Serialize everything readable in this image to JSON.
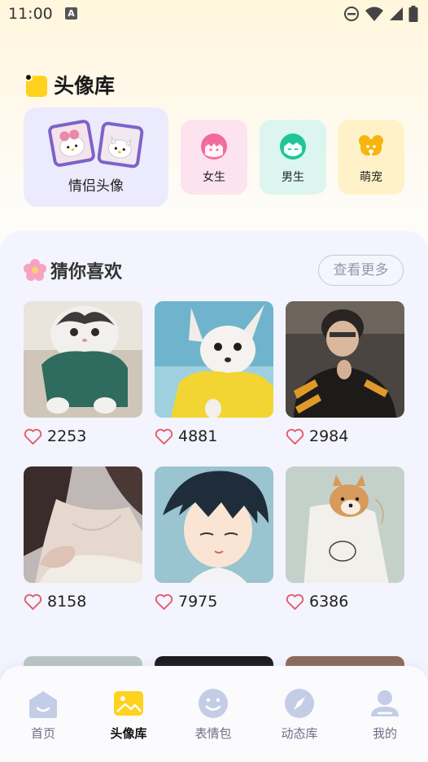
{
  "status": {
    "time": "11:00",
    "a_badge": "A"
  },
  "library": {
    "title": "头像库"
  },
  "categories": {
    "couple": "情侣头像",
    "girl": "女生",
    "boy": "男生",
    "pet": "萌宠"
  },
  "recommend": {
    "title": "猜你喜欢",
    "more": "查看更多"
  },
  "items": [
    {
      "likes": "2253",
      "subject": "cat in green sweater"
    },
    {
      "likes": "4881",
      "subject": "chihuahua in yellow sweater"
    },
    {
      "likes": "2984",
      "subject": "boy in striped jacket"
    },
    {
      "likes": "8158",
      "subject": "girl with necklace"
    },
    {
      "likes": "7975",
      "subject": "anime boy"
    },
    {
      "likes": "6386",
      "subject": "shiba in bag"
    }
  ],
  "nav": {
    "home": "首页",
    "avatar": "头像库",
    "emoji": "表情包",
    "dynamic": "动态库",
    "mine": "我的"
  },
  "colors": {
    "accent": "#ffd21f",
    "panel": "#f3f4fd",
    "couple_card": "#ecebfd"
  }
}
